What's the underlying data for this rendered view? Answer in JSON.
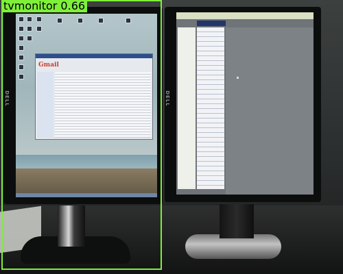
{
  "scene": {
    "left_monitor_brand": "DELL",
    "right_monitor_brand": "DELL",
    "left_screen_app_logo": "Gmail"
  },
  "detection": {
    "label": "tvmonitor",
    "score": "0.66",
    "display_text": "tvmonitor 0.66",
    "box_color": "#7ef03a"
  }
}
